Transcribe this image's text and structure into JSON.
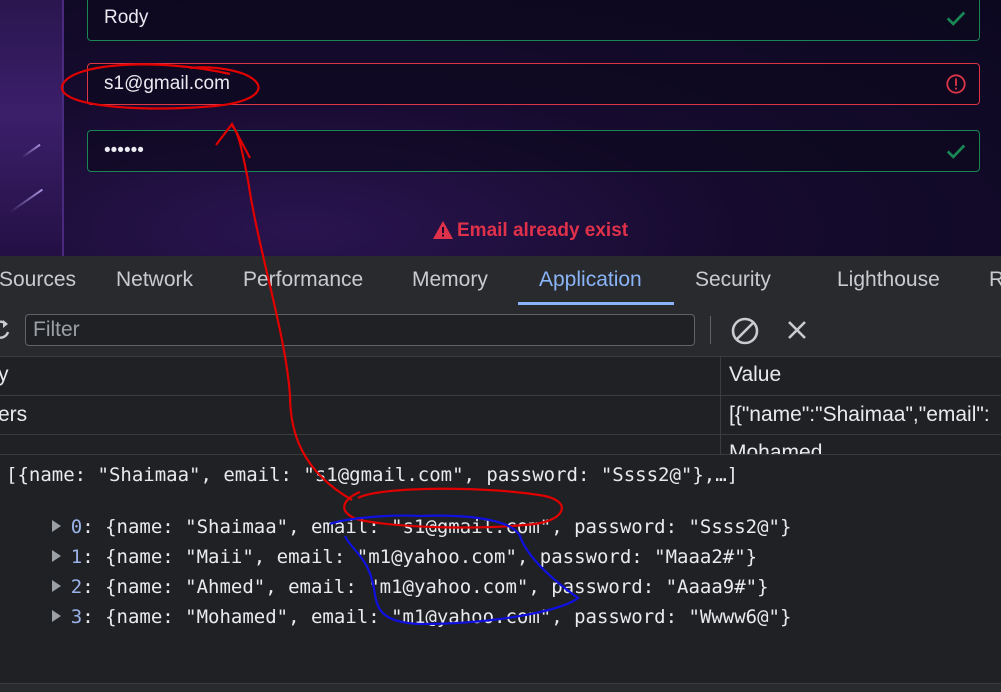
{
  "form": {
    "name_value": "Rody",
    "email_value": "s1@gmail.com",
    "password_value": "••••••",
    "error_message": "Email already exist"
  },
  "devtools": {
    "tabs": [
      "Sources",
      "Network",
      "Performance",
      "Memory",
      "Application",
      "Security",
      "Lighthouse",
      "R"
    ],
    "active_tab": "Application",
    "filter_placeholder": "Filter",
    "table": {
      "headers": [
        "y",
        "Value"
      ],
      "rows": [
        {
          "key": "ers",
          "value": "[{\"name\":\"Shaimaa\",\"email\":"
        },
        {
          "key": "",
          "value": "Mohamed"
        }
      ]
    },
    "console": {
      "summary": "[{name: \"Shaimaa\", email: \"s1@gmail.com\", password: \"Ssss2@\"},…]",
      "entries": [
        {
          "index": "0",
          "text": ": {name: \"Shaimaa\", email: \"s1@gmail.com\", password: \"Ssss2@\"}"
        },
        {
          "index": "1",
          "text": ": {name: \"Maii\", email: \"m1@yahoo.com\", password: \"Maaa2#\"}"
        },
        {
          "index": "2",
          "text": ": {name: \"Ahmed\", email: \"m1@yahoo.com\", password: \"Aaaa9#\"}"
        },
        {
          "index": "3",
          "text": ": {name: \"Mohamed\", email: \"m1@yahoo.com\", password: \"Wwww6@\"}"
        }
      ]
    }
  },
  "colors": {
    "valid": "#198754",
    "invalid": "#dc3545",
    "accent": "#8ab4f8",
    "annotation_red": "#e00000",
    "annotation_blue": "#1010e0"
  },
  "icons": [
    "check-icon",
    "exclamation-circle-icon",
    "warning-triangle-icon",
    "refresh-icon",
    "clear-icon",
    "close-icon",
    "expand-triangle-icon"
  ]
}
